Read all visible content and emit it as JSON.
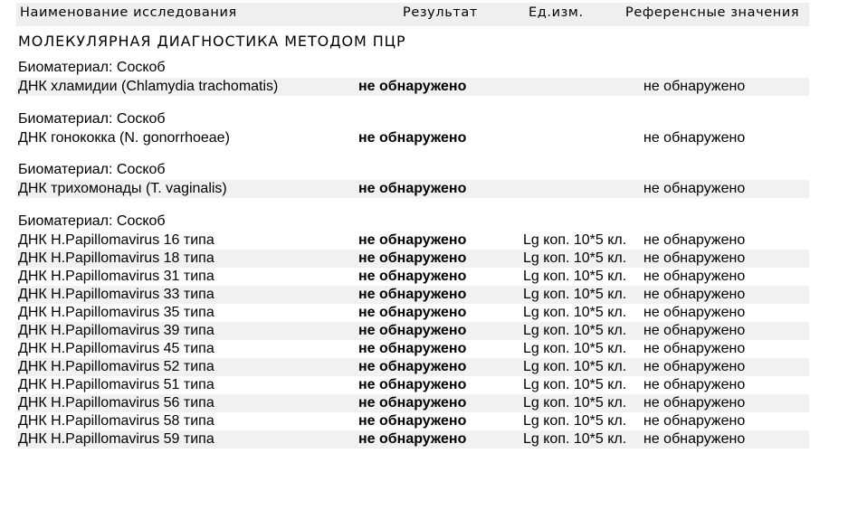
{
  "header": {
    "name": "Наименование исследования",
    "result": "Результат",
    "unit": "Ед.изм.",
    "reference": "Референсные значения"
  },
  "section_title": "МОЛЕКУЛЯРНАЯ ДИАГНОСТИКА МЕТОДОМ ПЦР",
  "groups": [
    {
      "biomaterial": "Биоматериал: Соскоб",
      "rows": [
        {
          "name": "ДНК хламидии (Chlamydia trachomatis)",
          "result": "не обнаружено",
          "unit": "",
          "ref": "не обнаружено"
        }
      ]
    },
    {
      "biomaterial": "Биоматериал: Соскоб",
      "rows": [
        {
          "name": "ДНК гонококка (N. gonorrhoeae)",
          "result": "не обнаружено",
          "unit": "",
          "ref": "не обнаружено"
        }
      ]
    },
    {
      "biomaterial": "Биоматериал: Соскоб",
      "rows": [
        {
          "name": "ДНК трихомонады (T. vaginalis)",
          "result": "не обнаружено",
          "unit": "",
          "ref": "не обнаружено"
        }
      ]
    },
    {
      "biomaterial": "Биоматериал: Соскоб",
      "rows": [
        {
          "name": "ДНК H.Papillomavirus 16 типа",
          "result": "не обнаружено",
          "unit": "Lg коп. 10*5 кл.",
          "ref": "не обнаружено"
        },
        {
          "name": "ДНК H.Papillomavirus 18 типа",
          "result": "не обнаружено",
          "unit": "Lg коп. 10*5 кл.",
          "ref": "не обнаружено"
        },
        {
          "name": "ДНК H.Papillomavirus 31 типа",
          "result": "не обнаружено",
          "unit": "Lg коп. 10*5 кл.",
          "ref": "не обнаружено"
        },
        {
          "name": "ДНК H.Papillomavirus 33 типа",
          "result": "не обнаружено",
          "unit": "Lg коп. 10*5 кл.",
          "ref": "не обнаружено"
        },
        {
          "name": "ДНК H.Papillomavirus 35 типа",
          "result": "не обнаружено",
          "unit": "Lg коп. 10*5 кл.",
          "ref": "не обнаружено"
        },
        {
          "name": "ДНК H.Papillomavirus 39 типа",
          "result": "не обнаружено",
          "unit": "Lg коп. 10*5 кл.",
          "ref": "не обнаружено"
        },
        {
          "name": "ДНК H.Papillomavirus 45 типа",
          "result": "не обнаружено",
          "unit": "Lg коп. 10*5 кл.",
          "ref": "не обнаружено"
        },
        {
          "name": "ДНК H.Papillomavirus 52 типа",
          "result": "не обнаружено",
          "unit": "Lg коп. 10*5 кл.",
          "ref": "не обнаружено"
        },
        {
          "name": "ДНК H.Papillomavirus 51 типа",
          "result": "не обнаружено",
          "unit": "Lg коп. 10*5 кл.",
          "ref": "не обнаружено"
        },
        {
          "name": "ДНК H.Papillomavirus 56 типа",
          "result": "не обнаружено",
          "unit": "Lg коп. 10*5 кл.",
          "ref": "не обнаружено"
        },
        {
          "name": "ДНК H.Papillomavirus 58 типа",
          "result": "не обнаружено",
          "unit": "Lg коп. 10*5 кл.",
          "ref": "не обнаружено"
        },
        {
          "name": "ДНК H.Papillomavirus 59 типа",
          "result": "не обнаружено",
          "unit": "Lg коп. 10*5 кл.",
          "ref": "не обнаружено"
        }
      ]
    }
  ]
}
